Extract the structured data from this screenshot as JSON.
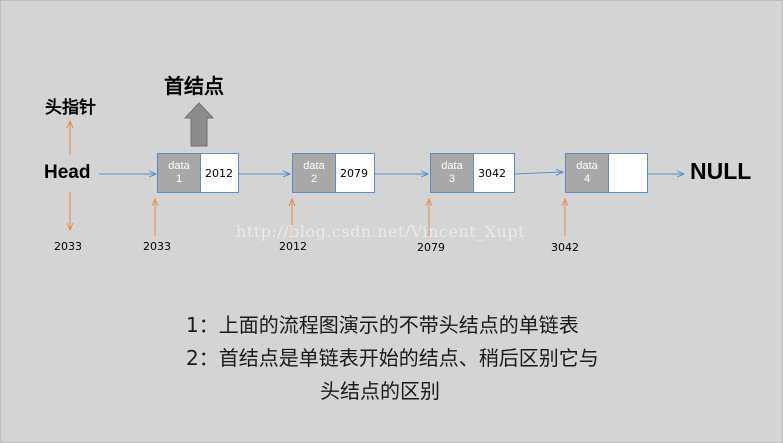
{
  "labels": {
    "head_pointer": "头指针",
    "first_node": "首结点",
    "head": "Head",
    "null": "NULL"
  },
  "nodes": [
    {
      "data_word": "data",
      "data_index": "1",
      "next": "2012",
      "addr": "2033"
    },
    {
      "data_word": "data",
      "data_index": "2",
      "next": "2079",
      "addr": "2012"
    },
    {
      "data_word": "data",
      "data_index": "3",
      "next": "3042",
      "addr": "2079"
    },
    {
      "data_word": "data",
      "data_index": "4",
      "next": "",
      "addr": "3042"
    }
  ],
  "head_addr": "2033",
  "watermark": "http://blog.csdn.net/Vincent_Xupt",
  "captions": [
    "1：上面的流程图演示的不带头结点的单链表",
    "2：首结点是单链表开始的结点、稍后区别它与",
    "头结点的区别"
  ],
  "colors": {
    "background": "#d4d4d4",
    "link_arrow": "#5a8ec9",
    "addr_arrow": "#e8894a",
    "data_cell": "#a8a8a8",
    "block_arrow": "#8c8c8c"
  }
}
